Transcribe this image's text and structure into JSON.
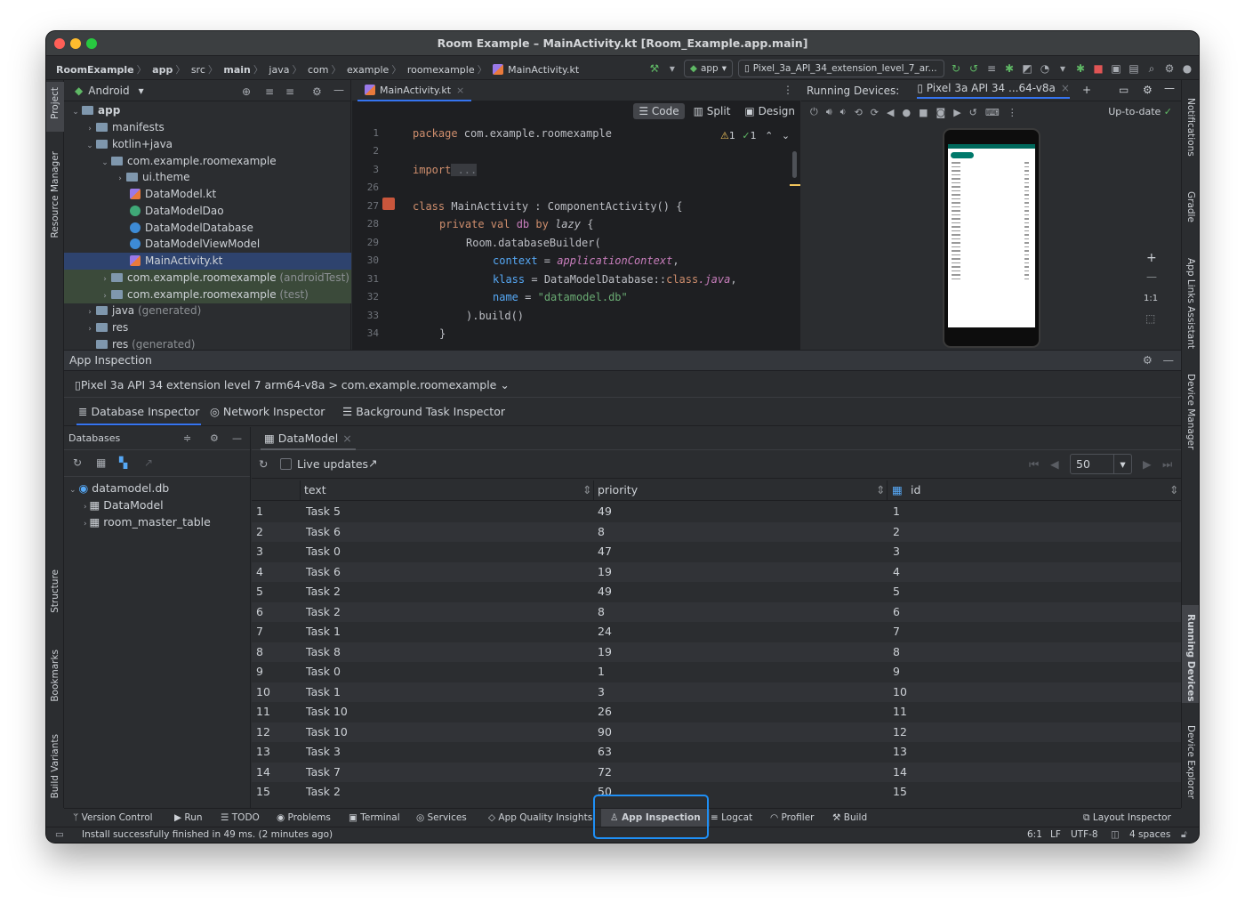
{
  "window": {
    "title": "Room Example – MainActivity.kt [Room_Example.app.main]"
  },
  "breadcrumb": [
    "RoomExample",
    "app",
    "src",
    "main",
    "java",
    "com",
    "example",
    "roomexample",
    "MainActivity.kt"
  ],
  "toolbar": {
    "run_config": "app",
    "device": "Pixel_3a_API_34_extension_level_7_ar..."
  },
  "left_strip": {
    "project": "Project",
    "resource_manager": "Resource Manager",
    "structure": "Structure",
    "bookmarks": "Bookmarks",
    "build_variants": "Build Variants"
  },
  "right_strip": {
    "notifications": "Notifications",
    "gradle": "Gradle",
    "app_links": "App Links Assistant",
    "device_manager": "Device Manager",
    "running_devices": "Running Devices",
    "device_explorer": "Device Explorer"
  },
  "project": {
    "view": "Android",
    "tree": [
      {
        "label": "app",
        "suffix": ""
      },
      {
        "label": "manifests",
        "suffix": ""
      },
      {
        "label": "kotlin+java",
        "suffix": ""
      },
      {
        "label": "com.example.roomexample",
        "suffix": ""
      },
      {
        "label": "ui.theme",
        "suffix": ""
      },
      {
        "label": "DataModel.kt",
        "suffix": ""
      },
      {
        "label": "DataModelDao",
        "suffix": ""
      },
      {
        "label": "DataModelDatabase",
        "suffix": ""
      },
      {
        "label": "DataModelViewModel",
        "suffix": ""
      },
      {
        "label": "MainActivity.kt",
        "suffix": ""
      },
      {
        "label": "com.example.roomexample",
        "suffix": " (androidTest)"
      },
      {
        "label": "com.example.roomexample",
        "suffix": " (test)"
      },
      {
        "label": "java",
        "suffix": " (generated)"
      },
      {
        "label": "res",
        "suffix": ""
      },
      {
        "label": "res",
        "suffix": " (generated)"
      }
    ]
  },
  "editor": {
    "tab": "MainActivity.kt",
    "modes": [
      "Code",
      "Split",
      "Design"
    ],
    "inspections": {
      "warnings": "1",
      "ok": "1"
    },
    "line_numbers": [
      "1",
      "2",
      "3",
      "26",
      "27",
      "28",
      "29",
      "30",
      "31",
      "32",
      "33",
      "34"
    ],
    "code": {
      "l1_kw": "package",
      "l1_rest": " com.example.roomexample",
      "l3_kw": "import",
      "l3_rest": " ...",
      "l27_kw": "class",
      "l27_rest": " MainActivity : ComponentActivity() {",
      "l28_kw": "private val",
      "l28_name": " db ",
      "l28_kw2": "by",
      "l28_fn": " lazy",
      "l28_rest": " {",
      "l29": "Room.databaseBuilder(",
      "l30_prm": "context",
      "l30_eq": " = ",
      "l30_val": "applicationContext",
      "l30_end": ",",
      "l31_prm": "klass",
      "l31_eq": " = ",
      "l31_val": "DataModelDatabase::",
      "l31_kw": "class",
      "l31_java": ".java",
      "l31_end": ",",
      "l32_prm": "name",
      "l32_eq": " = ",
      "l32_str": "\"datamodel.db\"",
      "l33": ").build()",
      "l34": "}"
    }
  },
  "running_devices": {
    "title": "Running Devices:",
    "device_tab": "Pixel 3a API 34 ...64-v8a",
    "status": "Up-to-date",
    "zoom_ratio": "1:1"
  },
  "app_inspection": {
    "title": "App Inspection",
    "device_path": "Pixel 3a API 34 extension level 7 arm64-v8a > com.example.roomexample",
    "tabs": [
      "Database Inspector",
      "Network Inspector",
      "Background Task Inspector"
    ],
    "databases_label": "Databases",
    "db_tree": [
      "datamodel.db",
      "DataModel",
      "room_master_table"
    ],
    "table_tab": "DataModel",
    "live_updates": "Live updates",
    "page_size": "50",
    "columns": [
      "text",
      "priority",
      "id"
    ],
    "rows": [
      [
        "1",
        "Task 5",
        "49",
        "1"
      ],
      [
        "2",
        "Task 6",
        "8",
        "2"
      ],
      [
        "3",
        "Task 0",
        "47",
        "3"
      ],
      [
        "4",
        "Task 6",
        "19",
        "4"
      ],
      [
        "5",
        "Task 2",
        "49",
        "5"
      ],
      [
        "6",
        "Task 2",
        "8",
        "6"
      ],
      [
        "7",
        "Task 1",
        "24",
        "7"
      ],
      [
        "8",
        "Task 8",
        "19",
        "8"
      ],
      [
        "9",
        "Task 0",
        "1",
        "9"
      ],
      [
        "10",
        "Task 1",
        "3",
        "10"
      ],
      [
        "11",
        "Task 10",
        "26",
        "11"
      ],
      [
        "12",
        "Task 10",
        "90",
        "12"
      ],
      [
        "13",
        "Task 3",
        "63",
        "13"
      ],
      [
        "14",
        "Task 7",
        "72",
        "14"
      ],
      [
        "15",
        "Task 2",
        "50",
        "15"
      ]
    ]
  },
  "bottom_tools": [
    "Version Control",
    "Run",
    "TODO",
    "Problems",
    "Terminal",
    "Services",
    "App Quality Insights",
    "App Inspection",
    "Logcat",
    "Profiler",
    "Build",
    "Layout Inspector"
  ],
  "status_bar": {
    "message": "Install successfully finished in 49 ms. (2 minutes ago)",
    "position": "6:1",
    "line_sep": "LF",
    "encoding": "UTF-8",
    "indent": "4 spaces"
  },
  "colors": {
    "accent": "#3574f0",
    "highlight": "#1f8ff5",
    "bg": "#2b2d30",
    "editor_bg": "#1e1f22"
  }
}
